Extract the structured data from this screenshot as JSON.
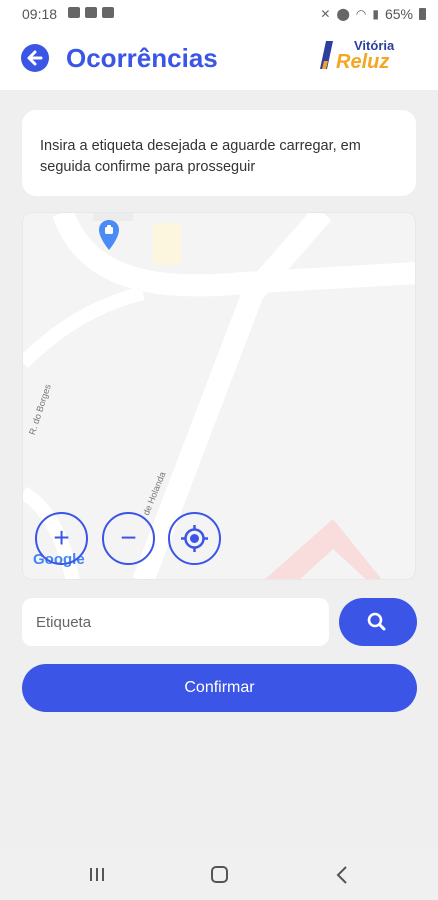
{
  "status_bar": {
    "time": "09:18",
    "battery": "65%",
    "icons_left": [
      "message-icon",
      "mail-icon",
      "image-icon"
    ],
    "icons_right": [
      "mute-icon",
      "location-icon",
      "wifi-icon",
      "signal-icon",
      "battery-icon"
    ]
  },
  "header": {
    "title": "Ocorrências",
    "logo_top": "Vitória",
    "logo_bottom": "Reluz"
  },
  "instruction": {
    "text": "Insira a etiqueta desejada e aguarde carregar, em seguida confirme para prosseguir"
  },
  "map": {
    "street_1": "R. do Borges",
    "street_2": "de Holanda",
    "attribution": "Google",
    "controls": [
      "zoom-in-icon",
      "zoom-out-icon",
      "locate-icon"
    ]
  },
  "search": {
    "placeholder": "Etiqueta",
    "value": ""
  },
  "confirm_label": "Confirmar",
  "colors": {
    "primary": "#3b55e6",
    "logo_orange": "#f5a623",
    "background": "#efefef"
  }
}
